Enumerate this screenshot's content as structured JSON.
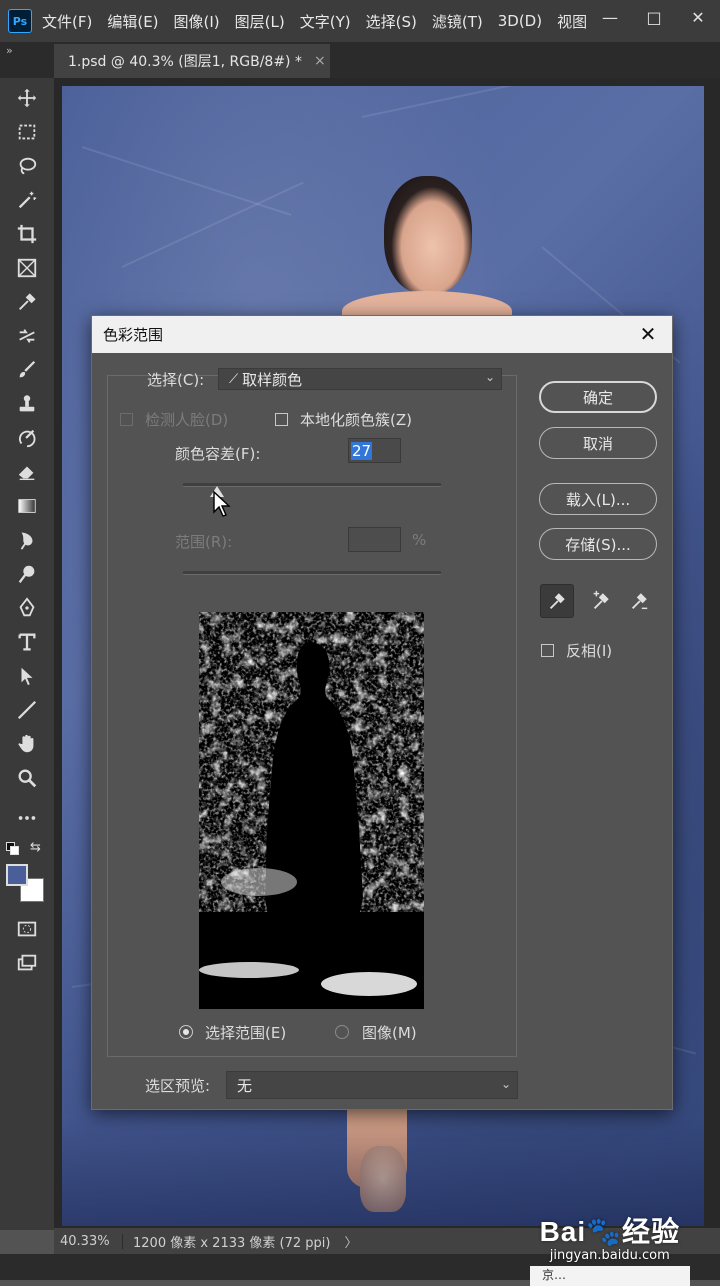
{
  "app": {
    "logo": "Ps"
  },
  "menu": [
    "文件(F)",
    "编辑(E)",
    "图像(I)",
    "图层(L)",
    "文字(Y)",
    "选择(S)",
    "滤镜(T)",
    "3D(D)",
    "视图"
  ],
  "window_controls": {
    "minimize": "—",
    "restore": "□",
    "close": "✕"
  },
  "document_tab": {
    "title": "1.psd @ 40.3% (图层1, RGB/8#) *",
    "close": "×"
  },
  "tools": [
    "move-icon",
    "marquee-icon",
    "lasso-icon",
    "magic-wand-icon",
    "crop-icon",
    "frame-icon",
    "eyedropper-icon",
    "healing-icon",
    "brush-icon",
    "stamp-icon",
    "history-brush-icon",
    "eraser-icon",
    "gradient-icon",
    "blur-icon",
    "dodge-icon",
    "pen-icon",
    "type-icon",
    "path-select-icon",
    "line-icon",
    "hand-icon",
    "zoom-icon",
    "more-icon"
  ],
  "colors": {
    "foreground": "#4a5f99",
    "background": "#ffffff"
  },
  "dialog": {
    "title": "色彩范围",
    "close": "✕",
    "select_label": "选择(C):",
    "select_value": "取样颜色",
    "detect_faces": "检测人脸(D)",
    "localized_clusters": "本地化颜色簇(Z)",
    "fuzziness_label": "颜色容差(F):",
    "fuzziness_value": "27",
    "fuzziness_fraction": 0.13,
    "range_label": "范围(R):",
    "range_unit": "%",
    "radio_selection": "选择范围(E)",
    "radio_image": "图像(M)",
    "preview_label": "选区预览:",
    "preview_value": "无",
    "buttons": {
      "ok": "确定",
      "cancel": "取消",
      "load": "载入(L)...",
      "save": "存储(S)..."
    },
    "invert": "反相(I)"
  },
  "status": {
    "zoom": "40.33%",
    "doc": "1200 像素 x 2133 像素 (72 ppi)",
    "arrow": "〉"
  },
  "watermark": {
    "logo": "Bai🐾经验",
    "url": "jingyan.baidu.com"
  },
  "notification": "京…"
}
